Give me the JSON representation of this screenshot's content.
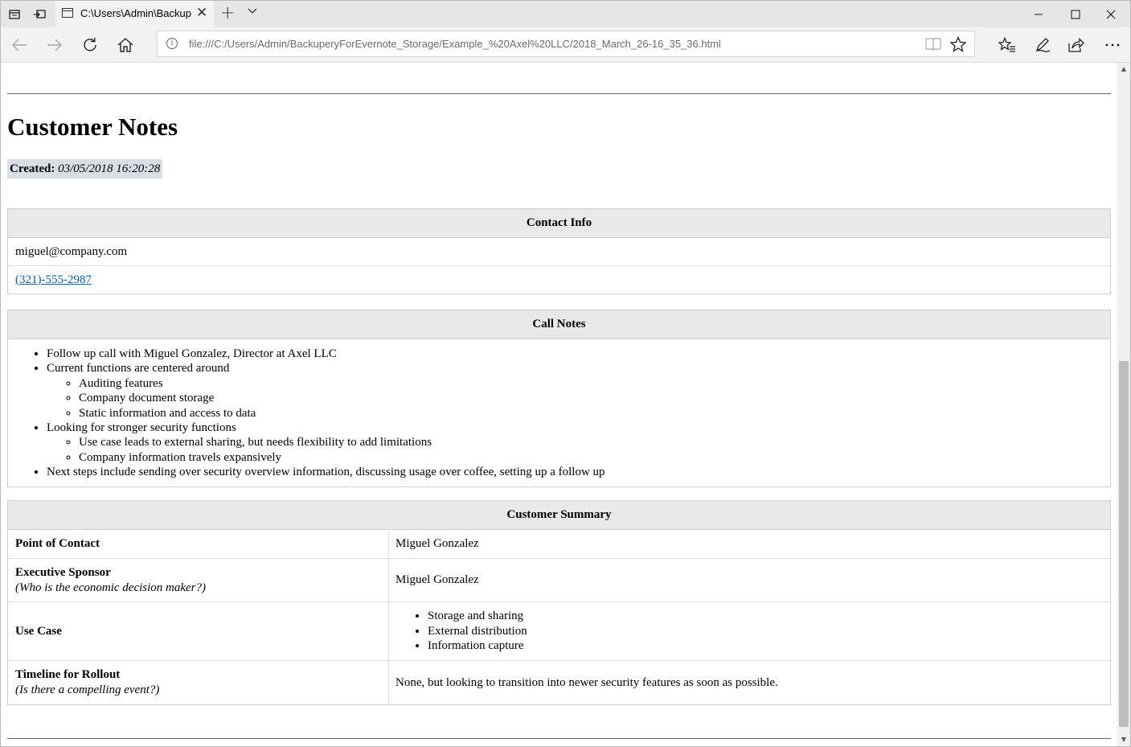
{
  "tab": {
    "title": "C:\\Users\\Admin\\Backup"
  },
  "address": {
    "url": "file:///C:/Users/Admin/BackuperyForEvernote_Storage/Example_%20Axel%20LLC/2018_March_26-16_35_36.html"
  },
  "note": {
    "title": "Customer Notes",
    "created_label": "Created:",
    "created_value": "03/05/2018 16:20:28"
  },
  "contact": {
    "header": "Contact Info",
    "email": "miguel@company.com",
    "phone": "(321)-555-2987"
  },
  "call_notes": {
    "header": "Call Notes",
    "items": [
      {
        "text": "Follow up call with Miguel Gonzalez, Director at Axel LLC"
      },
      {
        "text": "Current functions are centered around",
        "sub": [
          "Auditing features",
          "Company document storage",
          "Static information and access to data"
        ]
      },
      {
        "text": "Looking for stronger security functions",
        "sub": [
          "Use case leads to external sharing, but needs flexibility to add limitations",
          "Company information travels expansively"
        ]
      },
      {
        "text": "Next steps include sending over security overview information, discussing usage over coffee, setting up a follow up"
      }
    ]
  },
  "summary": {
    "header": "Customer Summary",
    "rows": [
      {
        "label": "Point of Contact",
        "value": "Miguel Gonzalez"
      },
      {
        "label": "Executive Sponsor",
        "hint": "(Who is the economic decision maker?)",
        "value": "Miguel Gonzalez"
      },
      {
        "label": "Use Case",
        "list": [
          "Storage and sharing",
          "External distribution",
          "Information capture"
        ]
      },
      {
        "label": "Timeline for Rollout",
        "hint": "(Is there a compelling event?)",
        "value": "None, but looking to transition into newer security features as soon as possible."
      }
    ]
  }
}
